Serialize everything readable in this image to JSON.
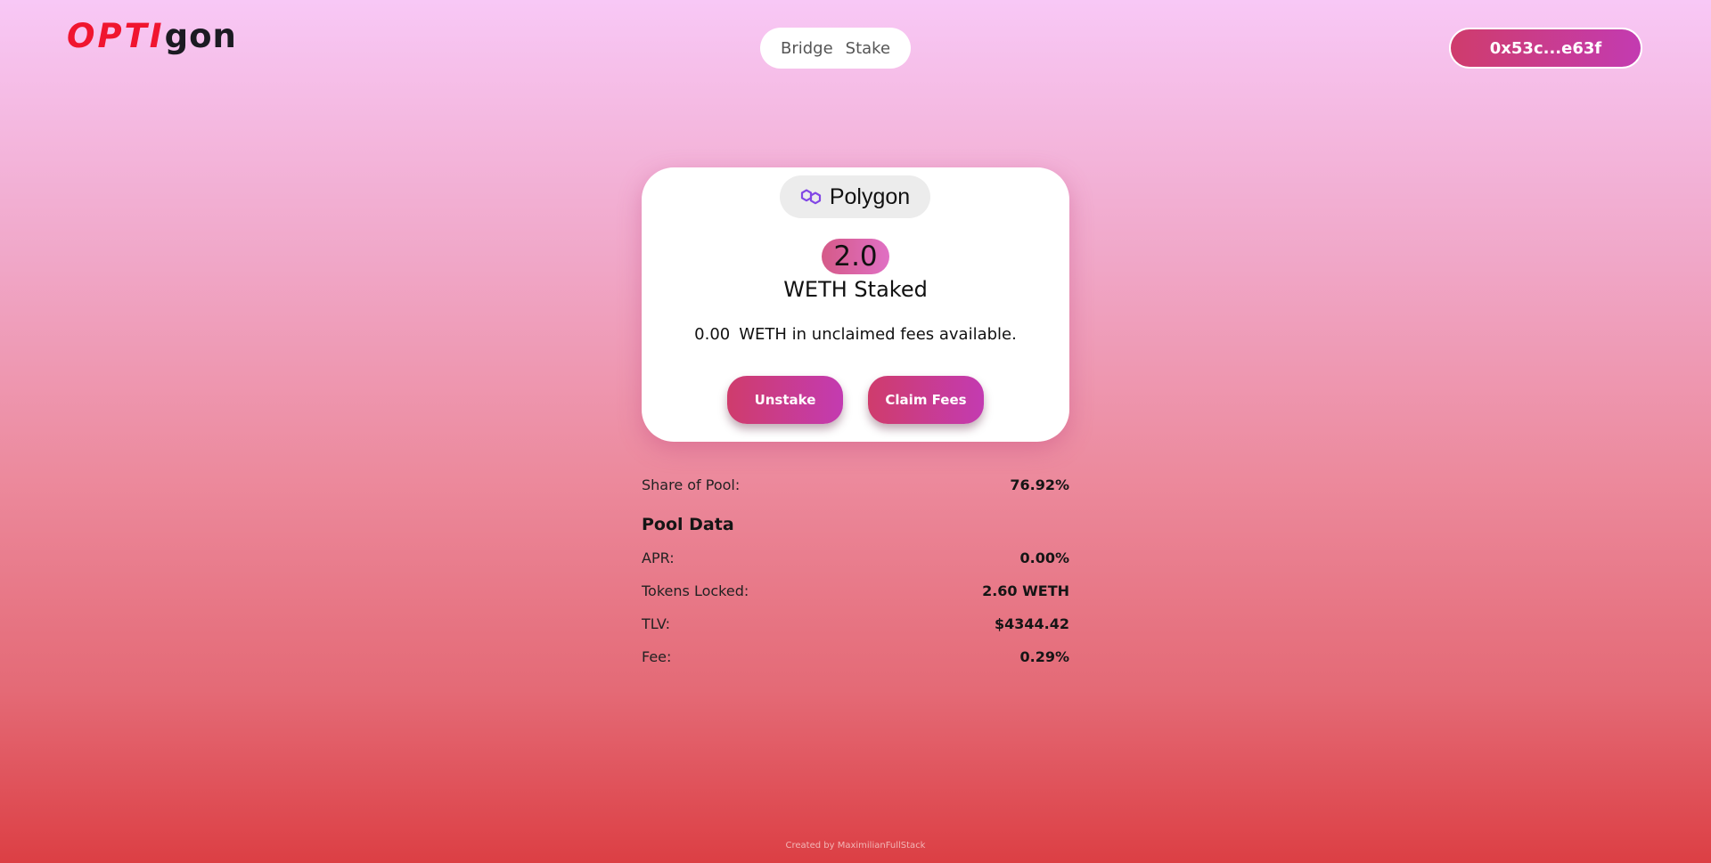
{
  "header": {
    "logo_part1": "OPTI",
    "logo_part2": "gon",
    "nav": [
      {
        "label": "Bridge"
      },
      {
        "label": "Stake"
      }
    ],
    "wallet_address": "0x53c...e63f"
  },
  "card": {
    "network_label": "Polygon",
    "network_icon": "polygon-logo-icon",
    "staked_amount": "2.0",
    "staked_label": "WETH Staked",
    "unclaimed_value": "0.00",
    "unclaimed_text": "WETH in unclaimed fees available.",
    "unstake_label": "Unstake",
    "claim_label": "Claim Fees"
  },
  "stats": {
    "share_label": "Share of Pool:",
    "share_value": "76.92%",
    "pool_title": "Pool Data",
    "rows": [
      {
        "label": "APR:",
        "value": "0.00%"
      },
      {
        "label": "Tokens Locked:",
        "value": "2.60 WETH"
      },
      {
        "label": "TLV:",
        "value": "$4344.42"
      },
      {
        "label": "Fee:",
        "value": "0.29%"
      }
    ]
  },
  "footer": {
    "credit": "Created by MaximilianFullStack"
  },
  "colors": {
    "brand_red": "#f0152f",
    "button_gradient_start": "#cf3c6c",
    "button_gradient_end": "#c33bb1",
    "polygon_purple": "#8247e5"
  }
}
